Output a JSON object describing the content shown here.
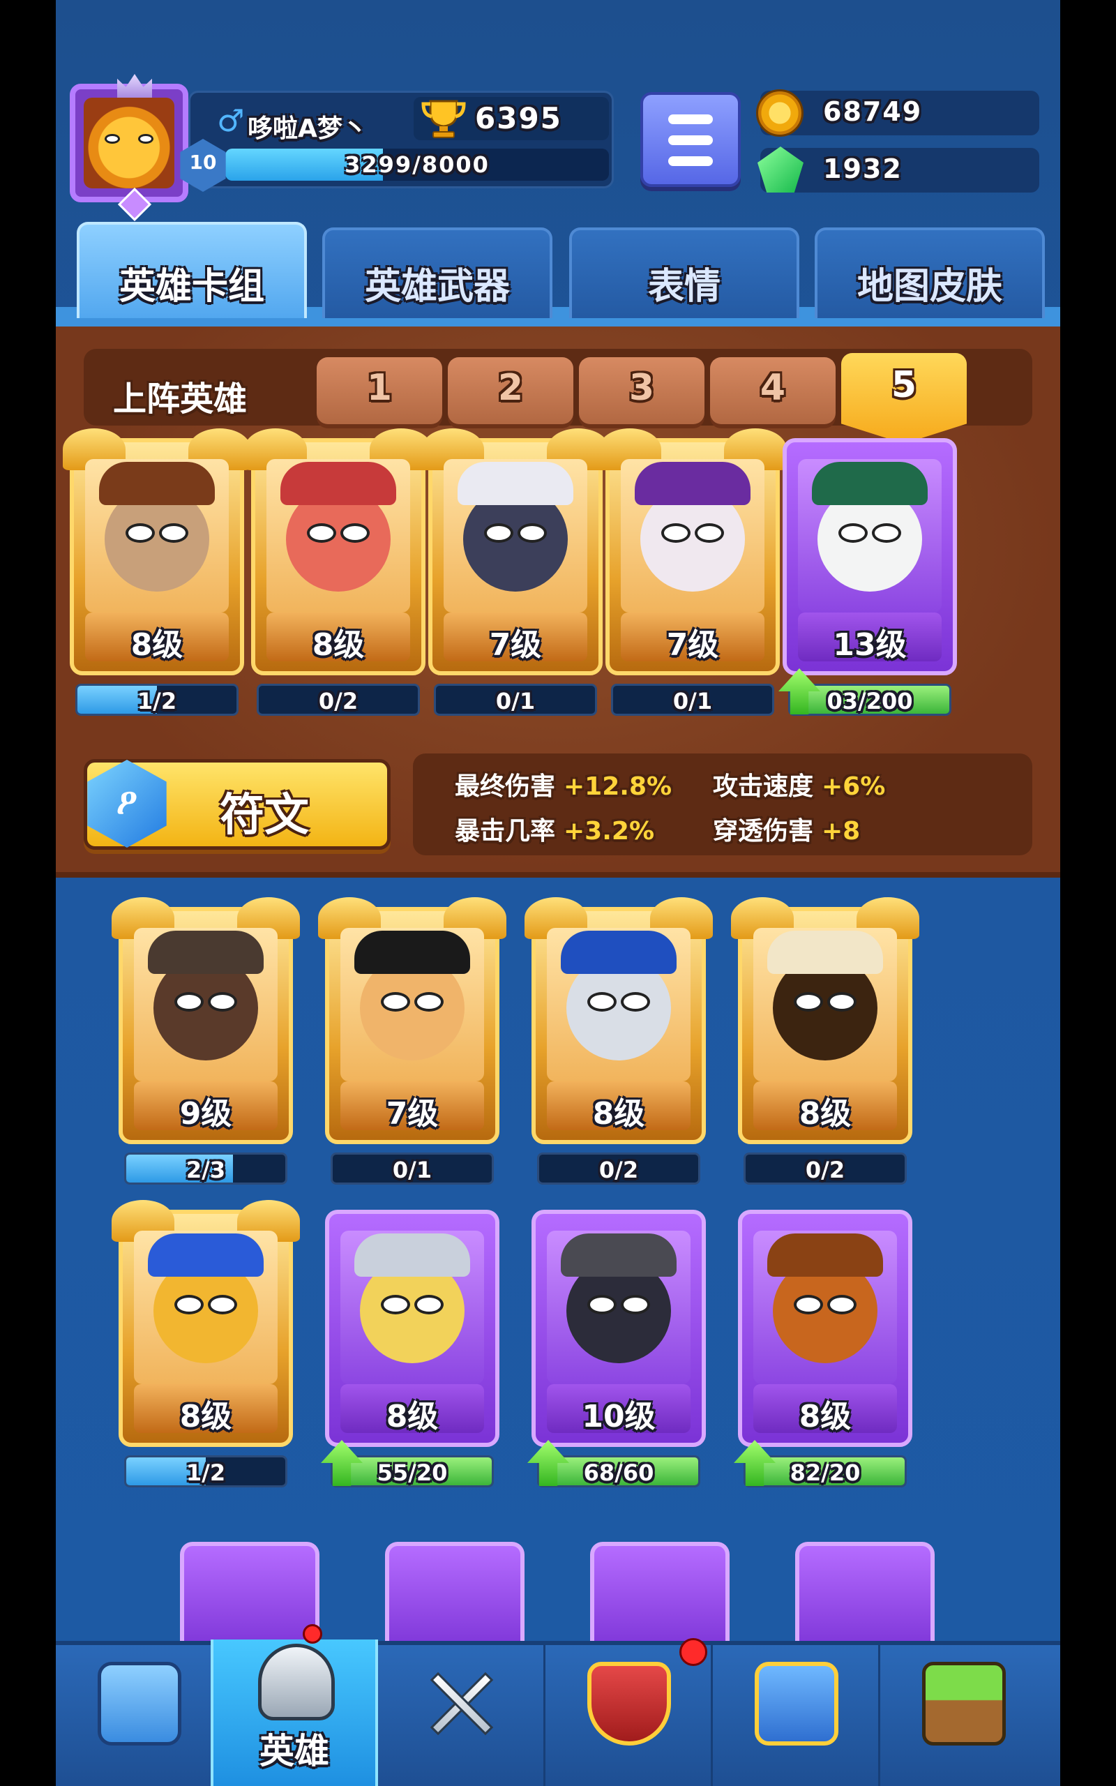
{
  "player": {
    "gender_symbol": "♂",
    "name": "哆啦A梦丶",
    "trophies": "6395",
    "level": "10",
    "xp_text": "3299/8000",
    "xp_fraction": 0.41
  },
  "resources": {
    "gold": "68749",
    "gems": "1932"
  },
  "tabs": [
    "英雄卡组",
    "英雄武器",
    "表情",
    "地图皮肤"
  ],
  "active_tab": 0,
  "lineup": {
    "title": "上阵英雄",
    "slots": [
      "1",
      "2",
      "3",
      "4",
      "5"
    ],
    "active_slot": 4,
    "cards": [
      {
        "rarity": "gold",
        "level": "8级",
        "progress": "1/2",
        "fraction": 0.5,
        "upgradable": false
      },
      {
        "rarity": "gold",
        "level": "8级",
        "progress": "0/2",
        "fraction": 0,
        "upgradable": false
      },
      {
        "rarity": "gold",
        "level": "7级",
        "progress": "0/1",
        "fraction": 0,
        "upgradable": false
      },
      {
        "rarity": "gold",
        "level": "7级",
        "progress": "0/1",
        "fraction": 0,
        "upgradable": false
      },
      {
        "rarity": "purple",
        "level": "13级",
        "progress": "03/200",
        "fraction": 1,
        "upgradable": true
      }
    ]
  },
  "rune": {
    "icon_glyph": "ዖ",
    "label": "符文",
    "stats": [
      {
        "name": "最终伤害",
        "value": "+12.8%"
      },
      {
        "name": "攻击速度",
        "value": "+6%"
      },
      {
        "name": "暴击几率",
        "value": "+3.2%"
      },
      {
        "name": "穿透伤害",
        "value": "+8"
      }
    ]
  },
  "collection": [
    {
      "rarity": "gold",
      "level": "9级",
      "progress": "2/3",
      "fraction": 0.67,
      "upgradable": false
    },
    {
      "rarity": "gold",
      "level": "7级",
      "progress": "0/1",
      "fraction": 0,
      "upgradable": false
    },
    {
      "rarity": "gold",
      "level": "8级",
      "progress": "0/2",
      "fraction": 0,
      "upgradable": false
    },
    {
      "rarity": "gold",
      "level": "8级",
      "progress": "0/2",
      "fraction": 0,
      "upgradable": false
    },
    {
      "rarity": "gold",
      "level": "8级",
      "progress": "1/2",
      "fraction": 0.5,
      "upgradable": false
    },
    {
      "rarity": "purple",
      "level": "8级",
      "progress": "55/20",
      "fraction": 1,
      "upgradable": true
    },
    {
      "rarity": "purple",
      "level": "10级",
      "progress": "68/60",
      "fraction": 1,
      "upgradable": true
    },
    {
      "rarity": "purple",
      "level": "8级",
      "progress": "82/20",
      "fraction": 1,
      "upgradable": true
    }
  ],
  "nav": {
    "items": [
      {
        "icon": "treasure-chest-icon",
        "label": ""
      },
      {
        "icon": "knight-helmet-icon",
        "label": "英雄"
      },
      {
        "icon": "crossed-swords-icon",
        "label": ""
      },
      {
        "icon": "crown-shield-icon",
        "label": ""
      },
      {
        "icon": "team-banner-icon",
        "label": ""
      },
      {
        "icon": "sprout-island-icon",
        "label": ""
      }
    ],
    "active": 1
  },
  "colors": {
    "gold_text": "#ffd43a",
    "panel_brown": "#77381c",
    "bg_blue": "#1e58a0"
  }
}
